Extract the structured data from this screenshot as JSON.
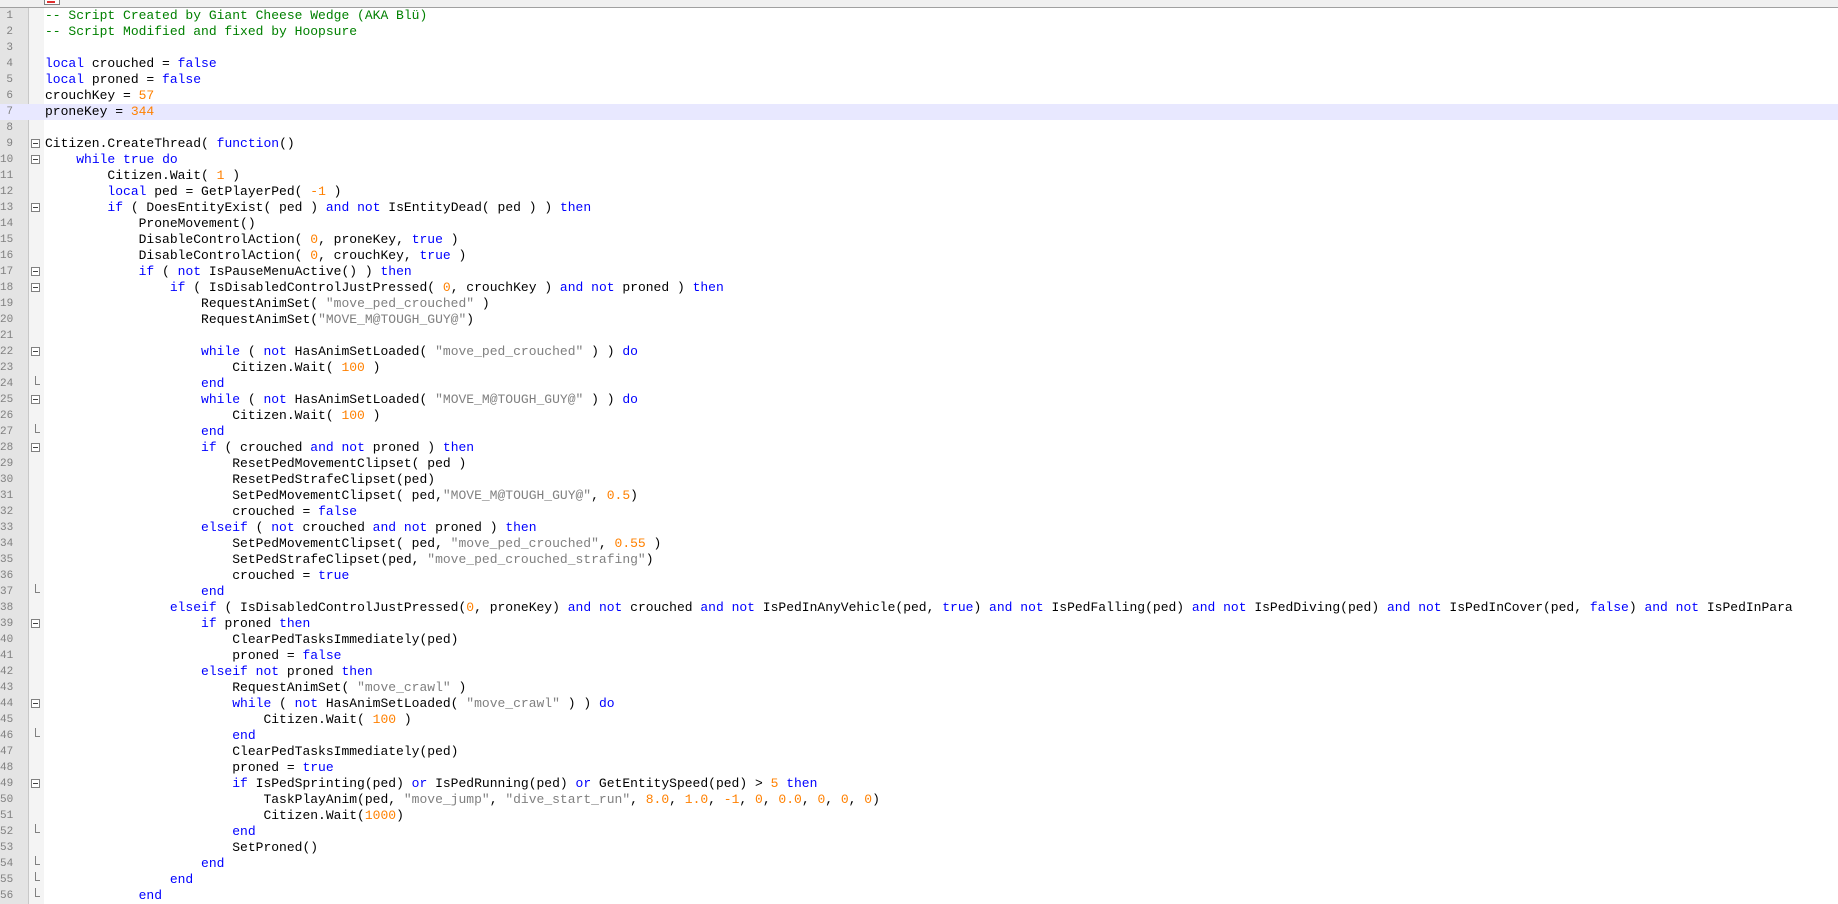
{
  "editor": {
    "accent_colors": {
      "keyword": "#0000ff",
      "number": "#ff8000",
      "string": "#808080",
      "comment": "#008000",
      "current_line": "#e8e8ff"
    },
    "current_line": 7,
    "lines": [
      {
        "n": "1",
        "i": 0,
        "f": "",
        "t": [
          [
            "c",
            "-- Script Created by Giant Cheese Wedge (AKA Blü)"
          ]
        ]
      },
      {
        "n": "2",
        "i": 0,
        "f": "",
        "t": [
          [
            "c",
            "-- Script Modified and fixed by Hoopsure"
          ]
        ]
      },
      {
        "n": "3",
        "i": 0,
        "f": "",
        "t": []
      },
      {
        "n": "4",
        "i": 0,
        "f": "",
        "t": [
          [
            "k",
            "local"
          ],
          [
            "t",
            " crouched = "
          ],
          [
            "k",
            "false"
          ]
        ]
      },
      {
        "n": "5",
        "i": 0,
        "f": "",
        "t": [
          [
            "k",
            "local"
          ],
          [
            "t",
            " proned = "
          ],
          [
            "k",
            "false"
          ]
        ]
      },
      {
        "n": "6",
        "i": 0,
        "f": "",
        "t": [
          [
            "t",
            "crouchKey = "
          ],
          [
            "n",
            "57"
          ]
        ]
      },
      {
        "n": "7",
        "i": 0,
        "f": "",
        "t": [
          [
            "t",
            "proneKey = "
          ],
          [
            "n",
            "344"
          ]
        ]
      },
      {
        "n": "8",
        "i": 0,
        "f": "",
        "t": []
      },
      {
        "n": "9",
        "i": 0,
        "f": "box",
        "t": [
          [
            "t",
            "Citizen.CreateThread( "
          ],
          [
            "k",
            "function"
          ],
          [
            "t",
            "()"
          ]
        ]
      },
      {
        "n": "10",
        "i": 1,
        "f": "box",
        "t": [
          [
            "k",
            "while"
          ],
          [
            "t",
            " "
          ],
          [
            "k",
            "true"
          ],
          [
            "t",
            " "
          ],
          [
            "k",
            "do"
          ]
        ]
      },
      {
        "n": "11",
        "i": 2,
        "f": "",
        "t": [
          [
            "t",
            "Citizen.Wait( "
          ],
          [
            "n",
            "1"
          ],
          [
            "t",
            " )"
          ]
        ]
      },
      {
        "n": "12",
        "i": 2,
        "f": "",
        "t": [
          [
            "k",
            "local"
          ],
          [
            "t",
            " ped = GetPlayerPed( "
          ],
          [
            "n",
            "-1"
          ],
          [
            "t",
            " )"
          ]
        ]
      },
      {
        "n": "13",
        "i": 2,
        "f": "box",
        "t": [
          [
            "k",
            "if"
          ],
          [
            "t",
            " ( DoesEntityExist( ped ) "
          ],
          [
            "k",
            "and"
          ],
          [
            "t",
            " "
          ],
          [
            "k",
            "not"
          ],
          [
            "t",
            " IsEntityDead( ped ) ) "
          ],
          [
            "k",
            "then"
          ]
        ]
      },
      {
        "n": "14",
        "i": 3,
        "f": "",
        "t": [
          [
            "t",
            "ProneMovement()"
          ]
        ]
      },
      {
        "n": "15",
        "i": 3,
        "f": "",
        "t": [
          [
            "t",
            "DisableControlAction( "
          ],
          [
            "n",
            "0"
          ],
          [
            "t",
            ", proneKey, "
          ],
          [
            "k",
            "true"
          ],
          [
            "t",
            " )"
          ]
        ]
      },
      {
        "n": "16",
        "i": 3,
        "f": "",
        "t": [
          [
            "t",
            "DisableControlAction( "
          ],
          [
            "n",
            "0"
          ],
          [
            "t",
            ", crouchKey, "
          ],
          [
            "k",
            "true"
          ],
          [
            "t",
            " )"
          ]
        ]
      },
      {
        "n": "17",
        "i": 3,
        "f": "box",
        "t": [
          [
            "k",
            "if"
          ],
          [
            "t",
            " ( "
          ],
          [
            "k",
            "not"
          ],
          [
            "t",
            " IsPauseMenuActive() ) "
          ],
          [
            "k",
            "then"
          ]
        ]
      },
      {
        "n": "18",
        "i": 4,
        "f": "box",
        "t": [
          [
            "k",
            "if"
          ],
          [
            "t",
            " ( IsDisabledControlJustPressed( "
          ],
          [
            "n",
            "0"
          ],
          [
            "t",
            ", crouchKey ) "
          ],
          [
            "k",
            "and"
          ],
          [
            "t",
            " "
          ],
          [
            "k",
            "not"
          ],
          [
            "t",
            " proned ) "
          ],
          [
            "k",
            "then"
          ]
        ]
      },
      {
        "n": "19",
        "i": 5,
        "f": "",
        "t": [
          [
            "t",
            "RequestAnimSet( "
          ],
          [
            "s",
            "\"move_ped_crouched\""
          ],
          [
            "t",
            " )"
          ]
        ]
      },
      {
        "n": "20",
        "i": 5,
        "f": "",
        "t": [
          [
            "t",
            "RequestAnimSet("
          ],
          [
            "s",
            "\"MOVE_M@TOUGH_GUY@\""
          ],
          [
            "t",
            ")"
          ]
        ]
      },
      {
        "n": "21",
        "i": 0,
        "f": "",
        "t": []
      },
      {
        "n": "22",
        "i": 5,
        "f": "box",
        "t": [
          [
            "k",
            "while"
          ],
          [
            "t",
            " ( "
          ],
          [
            "k",
            "not"
          ],
          [
            "t",
            " HasAnimSetLoaded( "
          ],
          [
            "s",
            "\"move_ped_crouched\""
          ],
          [
            "t",
            " ) ) "
          ],
          [
            "k",
            "do"
          ]
        ]
      },
      {
        "n": "23",
        "i": 6,
        "f": "",
        "t": [
          [
            "t",
            "Citizen.Wait( "
          ],
          [
            "n",
            "100"
          ],
          [
            "t",
            " )"
          ]
        ]
      },
      {
        "n": "24",
        "i": 5,
        "f": "end",
        "t": [
          [
            "k",
            "end"
          ]
        ]
      },
      {
        "n": "25",
        "i": 5,
        "f": "box",
        "t": [
          [
            "k",
            "while"
          ],
          [
            "t",
            " ( "
          ],
          [
            "k",
            "not"
          ],
          [
            "t",
            " HasAnimSetLoaded( "
          ],
          [
            "s",
            "\"MOVE_M@TOUGH_GUY@\""
          ],
          [
            "t",
            " ) ) "
          ],
          [
            "k",
            "do"
          ]
        ]
      },
      {
        "n": "26",
        "i": 6,
        "f": "",
        "t": [
          [
            "t",
            "Citizen.Wait( "
          ],
          [
            "n",
            "100"
          ],
          [
            "t",
            " )"
          ]
        ]
      },
      {
        "n": "27",
        "i": 5,
        "f": "end",
        "t": [
          [
            "k",
            "end"
          ]
        ]
      },
      {
        "n": "28",
        "i": 5,
        "f": "box",
        "t": [
          [
            "k",
            "if"
          ],
          [
            "t",
            " ( crouched "
          ],
          [
            "k",
            "and"
          ],
          [
            "t",
            " "
          ],
          [
            "k",
            "not"
          ],
          [
            "t",
            " proned ) "
          ],
          [
            "k",
            "then"
          ]
        ]
      },
      {
        "n": "29",
        "i": 6,
        "f": "",
        "t": [
          [
            "t",
            "ResetPedMovementClipset( ped )"
          ]
        ]
      },
      {
        "n": "30",
        "i": 6,
        "f": "",
        "t": [
          [
            "t",
            "ResetPedStrafeClipset(ped)"
          ]
        ]
      },
      {
        "n": "31",
        "i": 6,
        "f": "",
        "t": [
          [
            "t",
            "SetPedMovementClipset( ped,"
          ],
          [
            "s",
            "\"MOVE_M@TOUGH_GUY@\""
          ],
          [
            "t",
            ", "
          ],
          [
            "n",
            "0.5"
          ],
          [
            "t",
            ")"
          ]
        ]
      },
      {
        "n": "32",
        "i": 6,
        "f": "",
        "t": [
          [
            "t",
            "crouched = "
          ],
          [
            "k",
            "false"
          ]
        ]
      },
      {
        "n": "33",
        "i": 5,
        "f": "",
        "t": [
          [
            "k",
            "elseif"
          ],
          [
            "t",
            " ( "
          ],
          [
            "k",
            "not"
          ],
          [
            "t",
            " crouched "
          ],
          [
            "k",
            "and"
          ],
          [
            "t",
            " "
          ],
          [
            "k",
            "not"
          ],
          [
            "t",
            " proned ) "
          ],
          [
            "k",
            "then"
          ]
        ]
      },
      {
        "n": "34",
        "i": 6,
        "f": "",
        "t": [
          [
            "t",
            "SetPedMovementClipset( ped, "
          ],
          [
            "s",
            "\"move_ped_crouched\""
          ],
          [
            "t",
            ", "
          ],
          [
            "n",
            "0.55"
          ],
          [
            "t",
            " )"
          ]
        ]
      },
      {
        "n": "35",
        "i": 6,
        "f": "",
        "t": [
          [
            "t",
            "SetPedStrafeClipset(ped, "
          ],
          [
            "s",
            "\"move_ped_crouched_strafing\""
          ],
          [
            "t",
            ")"
          ]
        ]
      },
      {
        "n": "36",
        "i": 6,
        "f": "",
        "t": [
          [
            "t",
            "crouched = "
          ],
          [
            "k",
            "true"
          ]
        ]
      },
      {
        "n": "37",
        "i": 5,
        "f": "end",
        "t": [
          [
            "k",
            "end"
          ]
        ]
      },
      {
        "n": "38",
        "i": 4,
        "f": "",
        "t": [
          [
            "k",
            "elseif"
          ],
          [
            "t",
            " ( IsDisabledControlJustPressed("
          ],
          [
            "n",
            "0"
          ],
          [
            "t",
            ", proneKey) "
          ],
          [
            "k",
            "and"
          ],
          [
            "t",
            " "
          ],
          [
            "k",
            "not"
          ],
          [
            "t",
            " crouched "
          ],
          [
            "k",
            "and"
          ],
          [
            "t",
            " "
          ],
          [
            "k",
            "not"
          ],
          [
            "t",
            " IsPedInAnyVehicle(ped, "
          ],
          [
            "k",
            "true"
          ],
          [
            "t",
            ") "
          ],
          [
            "k",
            "and"
          ],
          [
            "t",
            " "
          ],
          [
            "k",
            "not"
          ],
          [
            "t",
            " IsPedFalling(ped) "
          ],
          [
            "k",
            "and"
          ],
          [
            "t",
            " "
          ],
          [
            "k",
            "not"
          ],
          [
            "t",
            " IsPedDiving(ped) "
          ],
          [
            "k",
            "and"
          ],
          [
            "t",
            " "
          ],
          [
            "k",
            "not"
          ],
          [
            "t",
            " IsPedInCover(ped, "
          ],
          [
            "k",
            "false"
          ],
          [
            "t",
            ") "
          ],
          [
            "k",
            "and"
          ],
          [
            "t",
            " "
          ],
          [
            "k",
            "not"
          ],
          [
            "t",
            " IsPedInPara"
          ]
        ]
      },
      {
        "n": "39",
        "i": 5,
        "f": "box",
        "t": [
          [
            "k",
            "if"
          ],
          [
            "t",
            " proned "
          ],
          [
            "k",
            "then"
          ]
        ]
      },
      {
        "n": "40",
        "i": 6,
        "f": "",
        "t": [
          [
            "t",
            "ClearPedTasksImmediately(ped)"
          ]
        ]
      },
      {
        "n": "41",
        "i": 6,
        "f": "",
        "t": [
          [
            "t",
            "proned = "
          ],
          [
            "k",
            "false"
          ]
        ]
      },
      {
        "n": "42",
        "i": 5,
        "f": "",
        "t": [
          [
            "k",
            "elseif"
          ],
          [
            "t",
            " "
          ],
          [
            "k",
            "not"
          ],
          [
            "t",
            " proned "
          ],
          [
            "k",
            "then"
          ]
        ]
      },
      {
        "n": "43",
        "i": 6,
        "f": "",
        "t": [
          [
            "t",
            "RequestAnimSet( "
          ],
          [
            "s",
            "\"move_crawl\""
          ],
          [
            "t",
            " )"
          ]
        ]
      },
      {
        "n": "44",
        "i": 6,
        "f": "box",
        "t": [
          [
            "k",
            "while"
          ],
          [
            "t",
            " ( "
          ],
          [
            "k",
            "not"
          ],
          [
            "t",
            " HasAnimSetLoaded( "
          ],
          [
            "s",
            "\"move_crawl\""
          ],
          [
            "t",
            " ) ) "
          ],
          [
            "k",
            "do"
          ]
        ]
      },
      {
        "n": "45",
        "i": 7,
        "f": "",
        "t": [
          [
            "t",
            "Citizen.Wait( "
          ],
          [
            "n",
            "100"
          ],
          [
            "t",
            " )"
          ]
        ]
      },
      {
        "n": "46",
        "i": 6,
        "f": "end",
        "t": [
          [
            "k",
            "end"
          ]
        ]
      },
      {
        "n": "47",
        "i": 6,
        "f": "",
        "t": [
          [
            "t",
            "ClearPedTasksImmediately(ped)"
          ]
        ]
      },
      {
        "n": "48",
        "i": 6,
        "f": "",
        "t": [
          [
            "t",
            "proned = "
          ],
          [
            "k",
            "true"
          ]
        ]
      },
      {
        "n": "49",
        "i": 6,
        "f": "box",
        "t": [
          [
            "k",
            "if"
          ],
          [
            "t",
            " IsPedSprinting(ped) "
          ],
          [
            "k",
            "or"
          ],
          [
            "t",
            " IsPedRunning(ped) "
          ],
          [
            "k",
            "or"
          ],
          [
            "t",
            " GetEntitySpeed(ped) > "
          ],
          [
            "n",
            "5"
          ],
          [
            "t",
            " "
          ],
          [
            "k",
            "then"
          ]
        ]
      },
      {
        "n": "50",
        "i": 7,
        "f": "",
        "t": [
          [
            "t",
            "TaskPlayAnim(ped, "
          ],
          [
            "s",
            "\"move_jump\""
          ],
          [
            "t",
            ", "
          ],
          [
            "s",
            "\"dive_start_run\""
          ],
          [
            "t",
            ", "
          ],
          [
            "n",
            "8.0"
          ],
          [
            "t",
            ", "
          ],
          [
            "n",
            "1.0"
          ],
          [
            "t",
            ", "
          ],
          [
            "n",
            "-1"
          ],
          [
            "t",
            ", "
          ],
          [
            "n",
            "0"
          ],
          [
            "t",
            ", "
          ],
          [
            "n",
            "0.0"
          ],
          [
            "t",
            ", "
          ],
          [
            "n",
            "0"
          ],
          [
            "t",
            ", "
          ],
          [
            "n",
            "0"
          ],
          [
            "t",
            ", "
          ],
          [
            "n",
            "0"
          ],
          [
            "t",
            ")"
          ]
        ]
      },
      {
        "n": "51",
        "i": 7,
        "f": "",
        "t": [
          [
            "t",
            "Citizen.Wait("
          ],
          [
            "n",
            "1000"
          ],
          [
            "t",
            ")"
          ]
        ]
      },
      {
        "n": "52",
        "i": 6,
        "f": "end",
        "t": [
          [
            "k",
            "end"
          ]
        ]
      },
      {
        "n": "53",
        "i": 6,
        "f": "",
        "t": [
          [
            "t",
            "SetProned()"
          ]
        ]
      },
      {
        "n": "54",
        "i": 5,
        "f": "end",
        "t": [
          [
            "k",
            "end"
          ]
        ]
      },
      {
        "n": "55",
        "i": 4,
        "f": "end",
        "t": [
          [
            "k",
            "end"
          ]
        ]
      },
      {
        "n": "56",
        "i": 3,
        "f": "end",
        "t": [
          [
            "k",
            "end"
          ]
        ]
      }
    ]
  }
}
